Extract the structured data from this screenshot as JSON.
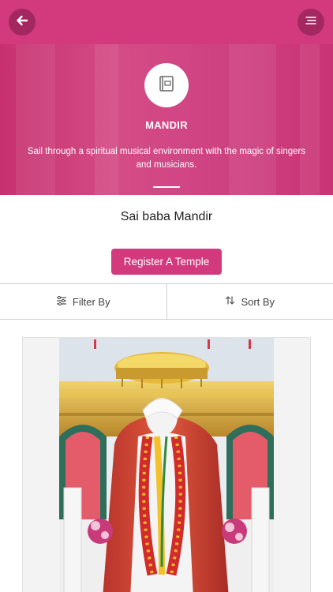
{
  "header": {
    "back_icon": "arrow-left-icon",
    "menu_icon": "menu-lines-icon"
  },
  "hero": {
    "icon": "book-icon",
    "title": "MANDIR",
    "description": "Sail through a spiritual musical environment with the magic of singers and musicians."
  },
  "page": {
    "title": "Sai baba Mandir",
    "register_label": "Register A Temple"
  },
  "toolbar": {
    "filter_label": "Filter By",
    "filter_icon": "filter-sliders-icon",
    "sort_label": "Sort By",
    "sort_icon": "sort-arrows-icon"
  },
  "colors": {
    "brand": "#d23a7d",
    "brand_dark": "#a32860"
  }
}
